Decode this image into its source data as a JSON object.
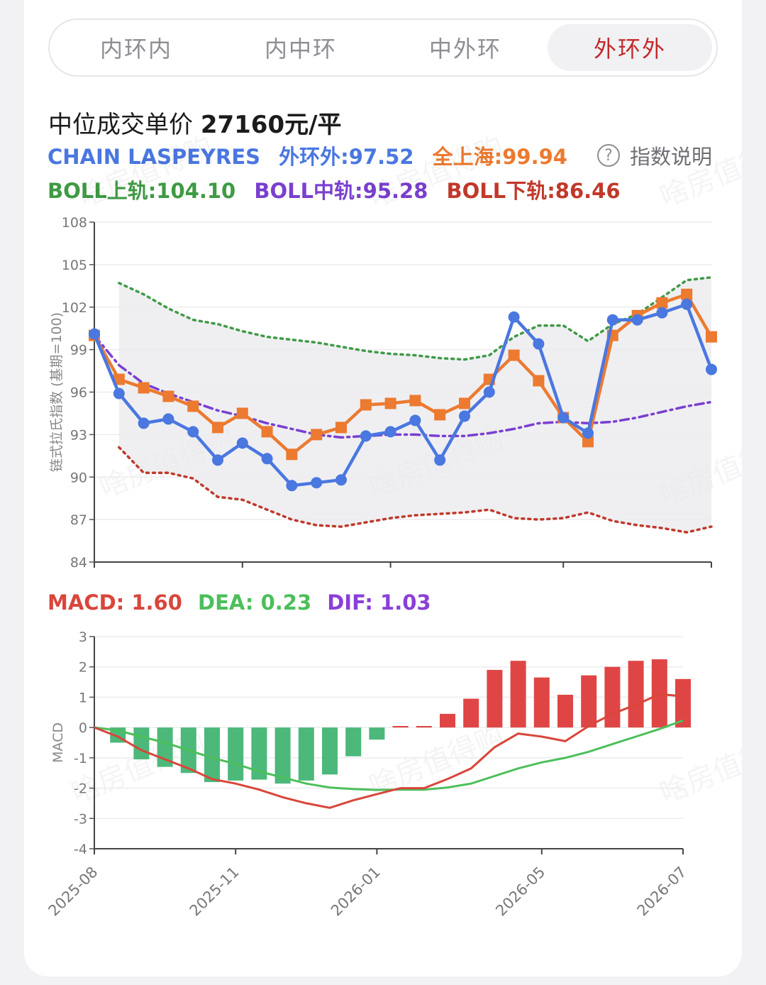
{
  "tabs": [
    {
      "label": "内环内",
      "active": false
    },
    {
      "label": "内中环",
      "active": false
    },
    {
      "label": "中外环",
      "active": false
    },
    {
      "label": "外环外",
      "active": true
    }
  ],
  "price": {
    "label": "中位成交单价",
    "value": "27160元/平"
  },
  "legend": {
    "chain": "CHAIN LASPEYRES",
    "ring": "外环外:97.52",
    "shanghai": "全上海:99.94",
    "boll_upper": "BOLL上轨:104.10",
    "boll_mid": "BOLL中轨:95.28",
    "boll_lower": "BOLL下轨:86.46"
  },
  "help_label": "指数说明",
  "help_icon": "question-circle-icon",
  "watermark": "啥房值得购",
  "macd_legend": {
    "macd": "MACD: 1.60",
    "dea": "DEA: 0.23",
    "dif": "DIF: 1.03"
  },
  "colors": {
    "ring": "#4a77e0",
    "shanghai": "#ec7a30",
    "boll_upper": "#3f9a45",
    "boll_mid": "#7a3fd0",
    "boll_lower": "#c0392b",
    "macd_pos": "#e04545",
    "macd_neg": "#4cb87a",
    "dea": "#4cbf5a",
    "dif": "#d9463b",
    "accent": "#c32a2a"
  },
  "chart_data": [
    {
      "type": "line",
      "ylabel": "链式拉氏指数 (基期=100)",
      "ylim": [
        84,
        108
      ],
      "yticks": [
        "108",
        "105",
        "102",
        "99",
        "96",
        "93",
        "90",
        "87",
        "84"
      ],
      "x_count": 26,
      "series": [
        {
          "key": "ring",
          "values": [
            100.1,
            95.9,
            93.8,
            94.1,
            93.2,
            91.2,
            92.4,
            91.3,
            89.4,
            89.6,
            89.8,
            92.9,
            93.2,
            94.0,
            91.2,
            94.3,
            96.0,
            101.3,
            99.4,
            94.2,
            93.1,
            101.1,
            101.1,
            101.6,
            102.2,
            97.6
          ]
        },
        {
          "key": "shanghai",
          "values": [
            100.0,
            96.9,
            96.3,
            95.7,
            95.0,
            93.5,
            94.5,
            93.2,
            91.6,
            93.0,
            93.5,
            95.1,
            95.2,
            95.4,
            94.4,
            95.2,
            96.9,
            98.6,
            96.8,
            94.2,
            92.5,
            100.0,
            101.4,
            102.3,
            102.9,
            99.9
          ]
        },
        {
          "key": "boll_upper",
          "values": [
            null,
            103.7,
            102.9,
            101.9,
            101.1,
            100.8,
            100.3,
            99.9,
            99.7,
            99.5,
            99.2,
            98.9,
            98.7,
            98.6,
            98.4,
            98.3,
            98.6,
            99.9,
            100.7,
            100.7,
            99.6,
            100.8,
            101.5,
            102.7,
            103.9,
            104.1
          ]
        },
        {
          "key": "boll_mid",
          "values": [
            100.0,
            97.9,
            96.6,
            95.9,
            95.3,
            94.7,
            94.3,
            93.8,
            93.4,
            93.0,
            92.8,
            92.9,
            93.0,
            93.0,
            92.9,
            92.9,
            93.1,
            93.4,
            93.8,
            93.9,
            93.8,
            93.9,
            94.2,
            94.6,
            95.0,
            95.3
          ]
        },
        {
          "key": "boll_lower",
          "values": [
            null,
            92.1,
            90.3,
            90.3,
            89.9,
            88.6,
            88.4,
            87.7,
            87.0,
            86.6,
            86.5,
            86.8,
            87.1,
            87.3,
            87.4,
            87.5,
            87.7,
            87.1,
            87.0,
            87.1,
            87.5,
            86.9,
            86.6,
            86.4,
            86.1,
            86.5
          ]
        }
      ]
    },
    {
      "type": "bar",
      "ylabel": "MACD",
      "ylim": [
        -4,
        3
      ],
      "yticks": [
        "3",
        "2",
        "1",
        "0",
        "-1",
        "-2",
        "-3",
        "-4"
      ],
      "x_count": 26,
      "xticks": [
        {
          "i": 0,
          "label": "2025-08"
        },
        {
          "i": 6,
          "label": "2025-11"
        },
        {
          "i": 12,
          "label": "2026-01"
        },
        {
          "i": 19,
          "label": "2026-05"
        },
        {
          "i": 25,
          "label": "2026-07"
        }
      ],
      "series": [
        {
          "key": "macd",
          "values": [
            null,
            -0.5,
            -1.05,
            -1.3,
            -1.5,
            -1.8,
            -1.75,
            -1.72,
            -1.85,
            -1.75,
            -1.55,
            -0.95,
            -0.4,
            0.05,
            0.05,
            0.45,
            0.95,
            1.9,
            2.2,
            1.65,
            1.08,
            1.72,
            2.0,
            2.2,
            2.25,
            1.6
          ]
        },
        {
          "key": "dif",
          "values": [
            0,
            -0.3,
            -0.75,
            -1.05,
            -1.35,
            -1.7,
            -1.85,
            -2.05,
            -2.3,
            -2.5,
            -2.65,
            -2.4,
            -2.2,
            -2.0,
            -2.0,
            -1.7,
            -1.35,
            -0.65,
            -0.2,
            -0.3,
            -0.45,
            0.05,
            0.45,
            0.75,
            1.1,
            1.03
          ]
        },
        {
          "key": "dea",
          "values": [
            0,
            -0.1,
            -0.3,
            -0.5,
            -0.75,
            -1.0,
            -1.2,
            -1.45,
            -1.65,
            -1.85,
            -1.98,
            -2.03,
            -2.06,
            -2.05,
            -2.05,
            -1.98,
            -1.85,
            -1.6,
            -1.35,
            -1.15,
            -1.0,
            -0.8,
            -0.55,
            -0.3,
            -0.05,
            0.23
          ]
        }
      ]
    }
  ]
}
